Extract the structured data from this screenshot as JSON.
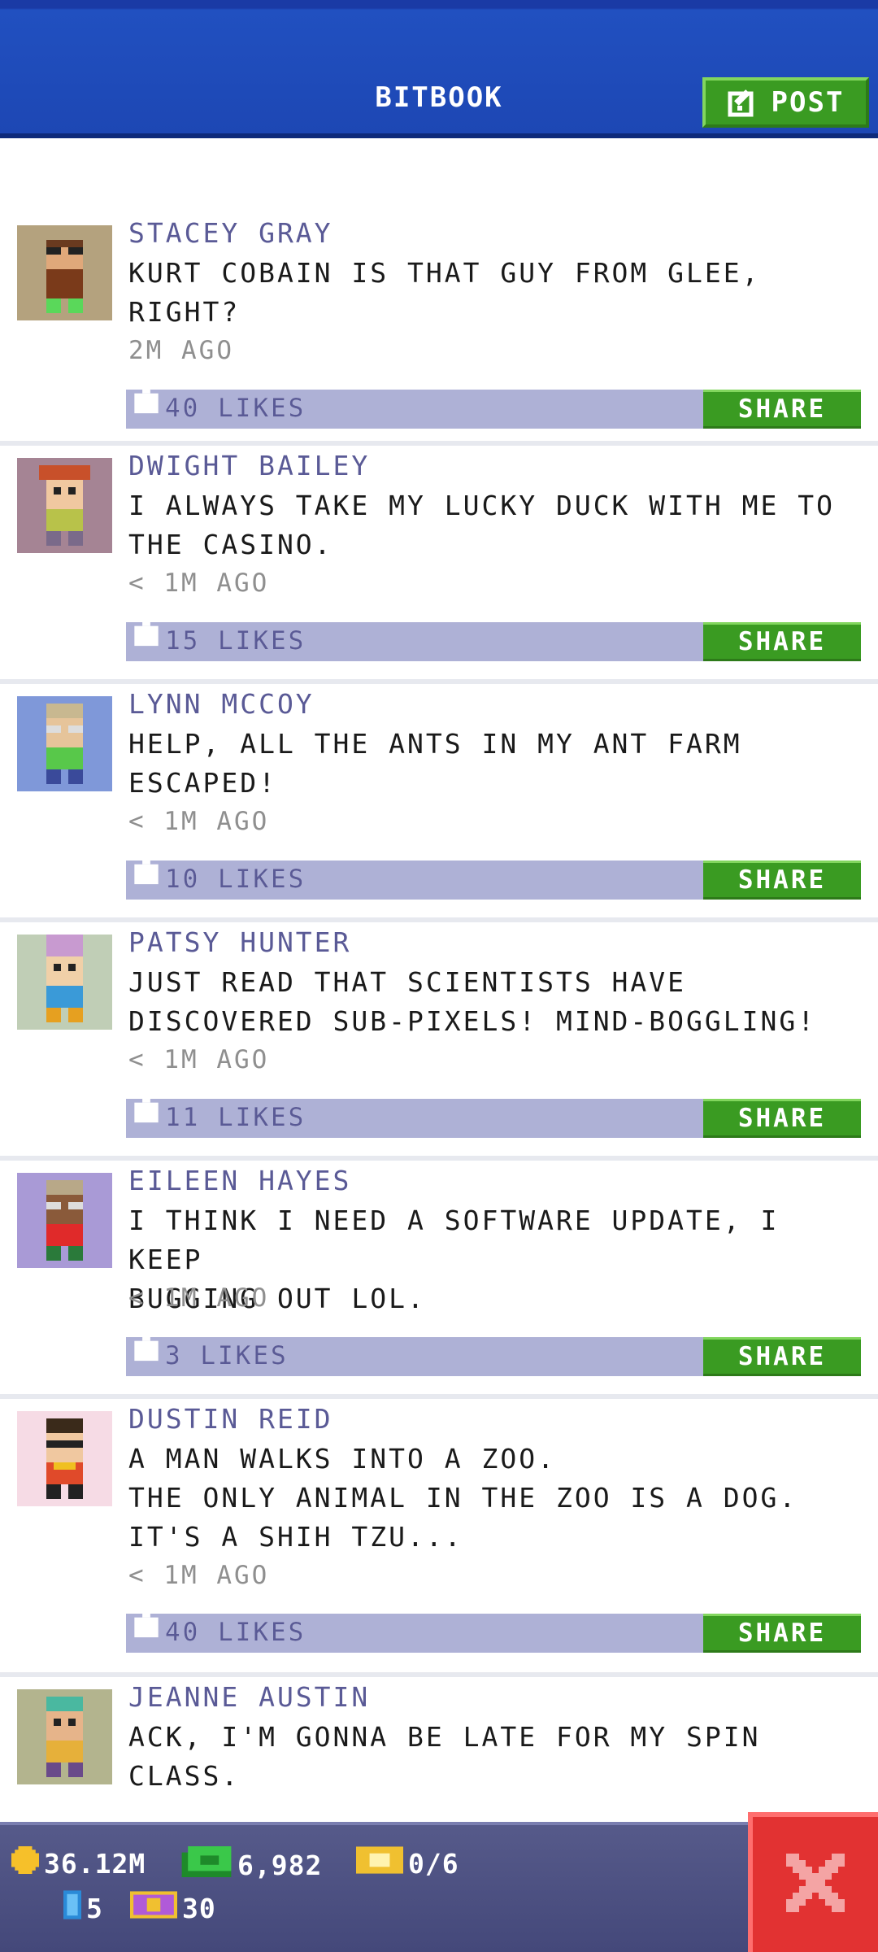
{
  "header": {
    "title": "BITBOOK",
    "post_label": "POST",
    "post_icon": "edit-icon"
  },
  "posts": [
    {
      "name": "STACEY GRAY",
      "message": "KURT COBAIN IS THAT GUY FROM GLEE,\nRIGHT?",
      "time": "2M AGO",
      "likes": "40 LIKES",
      "share": "SHARE",
      "avatar_bg": "#b4a27e"
    },
    {
      "name": "DWIGHT BAILEY",
      "message": "I ALWAYS TAKE MY LUCKY DUCK WITH ME TO\nTHE CASINO.",
      "time": "< 1M AGO",
      "likes": "15 LIKES",
      "share": "SHARE",
      "avatar_bg": "#a58494"
    },
    {
      "name": "LYNN MCCOY",
      "message": "HELP, ALL THE ANTS IN MY ANT FARM\nESCAPED!",
      "time": "< 1M AGO",
      "likes": "10 LIKES",
      "share": "SHARE",
      "avatar_bg": "#7f98d9"
    },
    {
      "name": "PATSY HUNTER",
      "message": "JUST READ THAT SCIENTISTS HAVE\nDISCOVERED SUB-PIXELS! MIND-BOGGLING!",
      "time": "< 1M AGO",
      "likes": "11 LIKES",
      "share": "SHARE",
      "avatar_bg": "#c0ceb6"
    },
    {
      "name": "EILEEN HAYES",
      "message": "I THINK I NEED A SOFTWARE UPDATE, I KEEP\nBUGGING OUT LOL.",
      "time": "< 1M AGO",
      "likes": "3 LIKES",
      "share": "SHARE",
      "avatar_bg": "#a99ad6"
    },
    {
      "name": "DUSTIN REID",
      "message": "A MAN WALKS INTO A ZOO.\nTHE ONLY ANIMAL IN THE ZOO IS A DOG.\nIT'S A SHIH TZU...",
      "time": "< 1M AGO",
      "likes": "40 LIKES",
      "share": "SHARE",
      "avatar_bg": "#f6dbe5"
    },
    {
      "name": "JEANNE AUSTIN",
      "message": "ACK, I'M GONNA BE LATE FOR MY SPIN\nCLASS.",
      "time": "",
      "likes": "",
      "share": "",
      "avatar_bg": "#b3b48e"
    }
  ],
  "status_bar": {
    "coins": "36.12M",
    "bux": "6,982",
    "tickets": "0/6",
    "elevators": "5",
    "vip": "30",
    "close_icon": "close-icon"
  },
  "colors": {
    "header_blue": "#1d47b4",
    "accent_green": "#3a9b22",
    "name_purple": "#5a5a96",
    "like_bar": "#aeb1d6",
    "close_red": "#e23232"
  }
}
